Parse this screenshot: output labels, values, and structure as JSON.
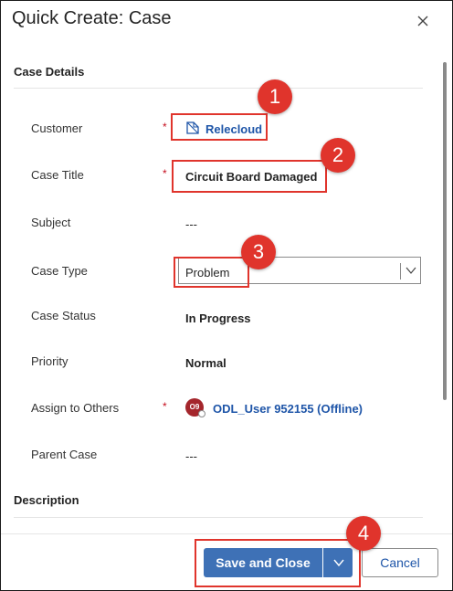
{
  "dialog": {
    "title": "Quick Create: Case"
  },
  "sections": {
    "case_details": "Case Details",
    "description": "Description"
  },
  "fields": {
    "customer": {
      "label": "Customer",
      "required": "*",
      "value": "Relecloud",
      "icon": "account-lookup-icon"
    },
    "case_title": {
      "label": "Case Title",
      "required": "*",
      "value": "Circuit Board Damaged"
    },
    "subject": {
      "label": "Subject",
      "value": "---"
    },
    "case_type": {
      "label": "Case Type",
      "value": "Problem"
    },
    "case_status": {
      "label": "Case Status",
      "value": "In Progress"
    },
    "priority": {
      "label": "Priority",
      "value": "Normal"
    },
    "assign_to_others": {
      "label": "Assign to Others",
      "required": "*",
      "avatar_initials": "O9",
      "value": "ODL_User 952155 (Offline)"
    },
    "parent_case": {
      "label": "Parent Case",
      "value": "---"
    }
  },
  "footer": {
    "save_label": "Save and Close",
    "cancel_label": "Cancel"
  },
  "callouts": [
    "1",
    "2",
    "3",
    "4"
  ],
  "colors": {
    "primary": "#3e71b6",
    "link": "#1e55a8",
    "callout": "#e0342c",
    "required": "#c50f1f",
    "avatar": "#a4262c"
  }
}
